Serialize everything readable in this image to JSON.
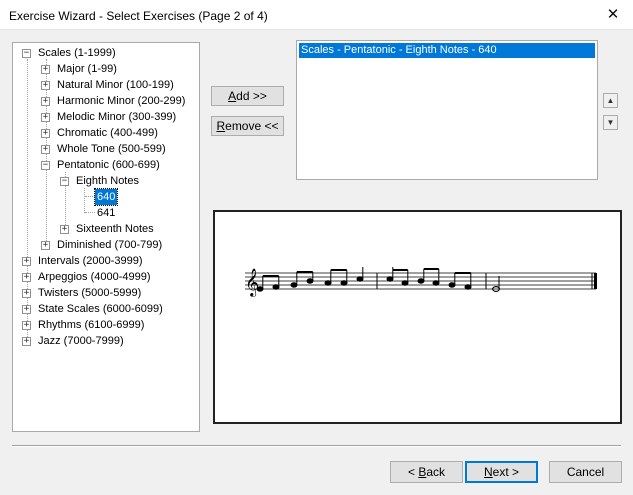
{
  "window": {
    "title": "Exercise Wizard - Select Exercises (Page 2 of 4)",
    "close_glyph": "✕"
  },
  "tree": [
    {
      "label": "Scales (1-1999)",
      "expander": "minus"
    },
    {
      "label": "Major (1-99)",
      "expander": "plus"
    },
    {
      "label": "Natural Minor (100-199)",
      "expander": "plus"
    },
    {
      "label": "Harmonic Minor (200-299)",
      "expander": "plus"
    },
    {
      "label": "Melodic Minor (300-399)",
      "expander": "plus"
    },
    {
      "label": "Chromatic (400-499)",
      "expander": "plus"
    },
    {
      "label": "Whole Tone (500-599)",
      "expander": "plus"
    },
    {
      "label": "Pentatonic (600-699)",
      "expander": "minus"
    },
    {
      "label": "Eighth Notes",
      "expander": "minus"
    },
    {
      "label": "640",
      "expander": "none",
      "selected": true
    },
    {
      "label": "641",
      "expander": "none"
    },
    {
      "label": "Sixteenth Notes",
      "expander": "plus"
    },
    {
      "label": "Diminished (700-799)",
      "expander": "plus"
    },
    {
      "label": "Intervals (2000-3999)",
      "expander": "plus"
    },
    {
      "label": "Arpeggios (4000-4999)",
      "expander": "plus"
    },
    {
      "label": "Twisters (5000-5999)",
      "expander": "plus"
    },
    {
      "label": "State Scales (6000-6099)",
      "expander": "plus"
    },
    {
      "label": "Rhythms (6100-6999)",
      "expander": "plus"
    },
    {
      "label": "Jazz (7000-7999)",
      "expander": "plus"
    }
  ],
  "buttons": {
    "add_underline": "A",
    "add_rest": "dd >>",
    "remove_underline": "R",
    "remove_rest": "emove <<",
    "back_prefix": "< ",
    "back_underline": "B",
    "back_rest": "ack",
    "next_underline": "N",
    "next_rest": "ext >",
    "cancel": "Cancel"
  },
  "selected_exercises": [
    "Scales  - Pentatonic  - Eighth Notes - 640"
  ],
  "colors": {
    "selection": "#0078d7",
    "default_button_border": "#0078d7"
  },
  "icons": {
    "move_up": "▲",
    "move_down": "▼"
  }
}
